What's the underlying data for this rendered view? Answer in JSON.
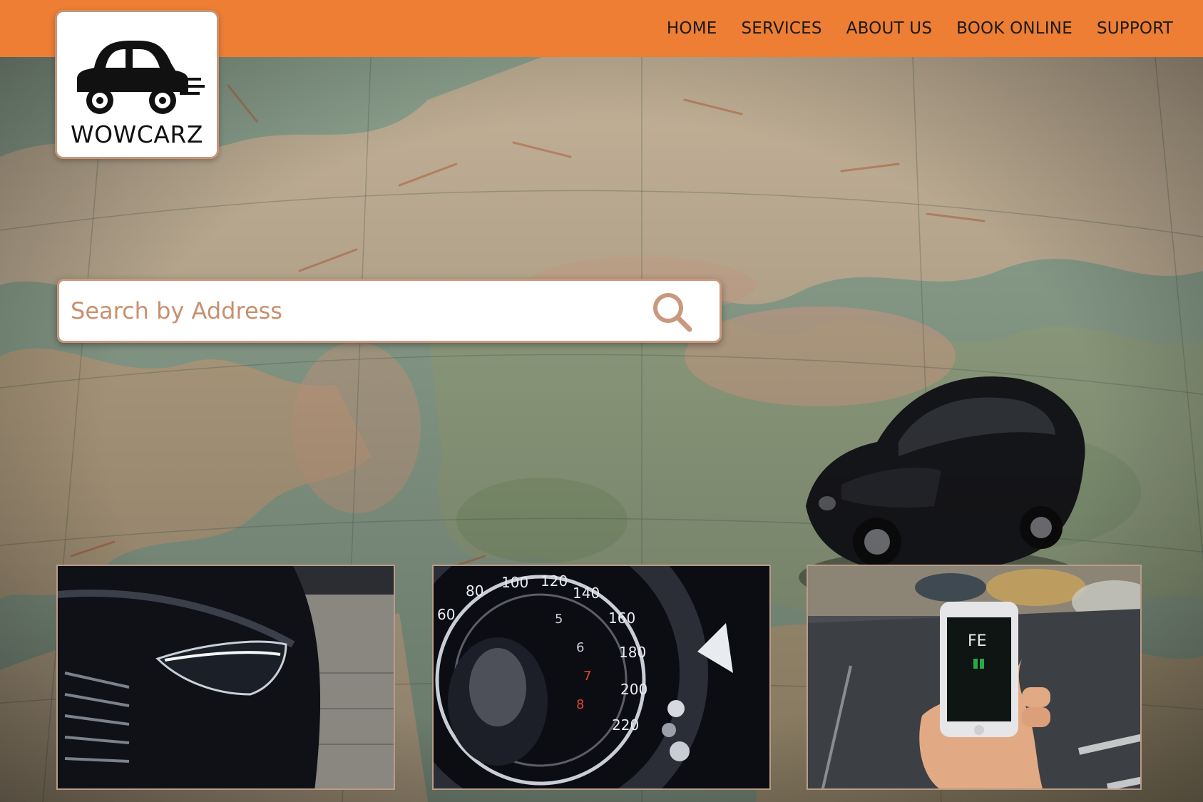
{
  "brand": {
    "name": "WOWCARZ",
    "logo_icon": "car-icon"
  },
  "nav": {
    "items": [
      {
        "label": "HOME"
      },
      {
        "label": "SERVICES"
      },
      {
        "label": "ABOUT US"
      },
      {
        "label": "BOOK ONLINE"
      },
      {
        "label": "SUPPORT"
      }
    ]
  },
  "search": {
    "placeholder": "Search by Address",
    "icon": "search-icon"
  },
  "cards": [
    {
      "subject": "car-headlight"
    },
    {
      "subject": "speedometer",
      "gauge_labels": [
        "60",
        "80",
        "100",
        "120",
        "140",
        "160",
        "180",
        "200",
        "220"
      ],
      "inner_labels": [
        "5",
        "6",
        "7",
        "8"
      ]
    },
    {
      "subject": "phone-in-hand",
      "screen_text": "FE"
    }
  ],
  "colors": {
    "header_bg": "#ed7e34",
    "accent_border": "#c9987e",
    "placeholder": "#c8906e"
  }
}
